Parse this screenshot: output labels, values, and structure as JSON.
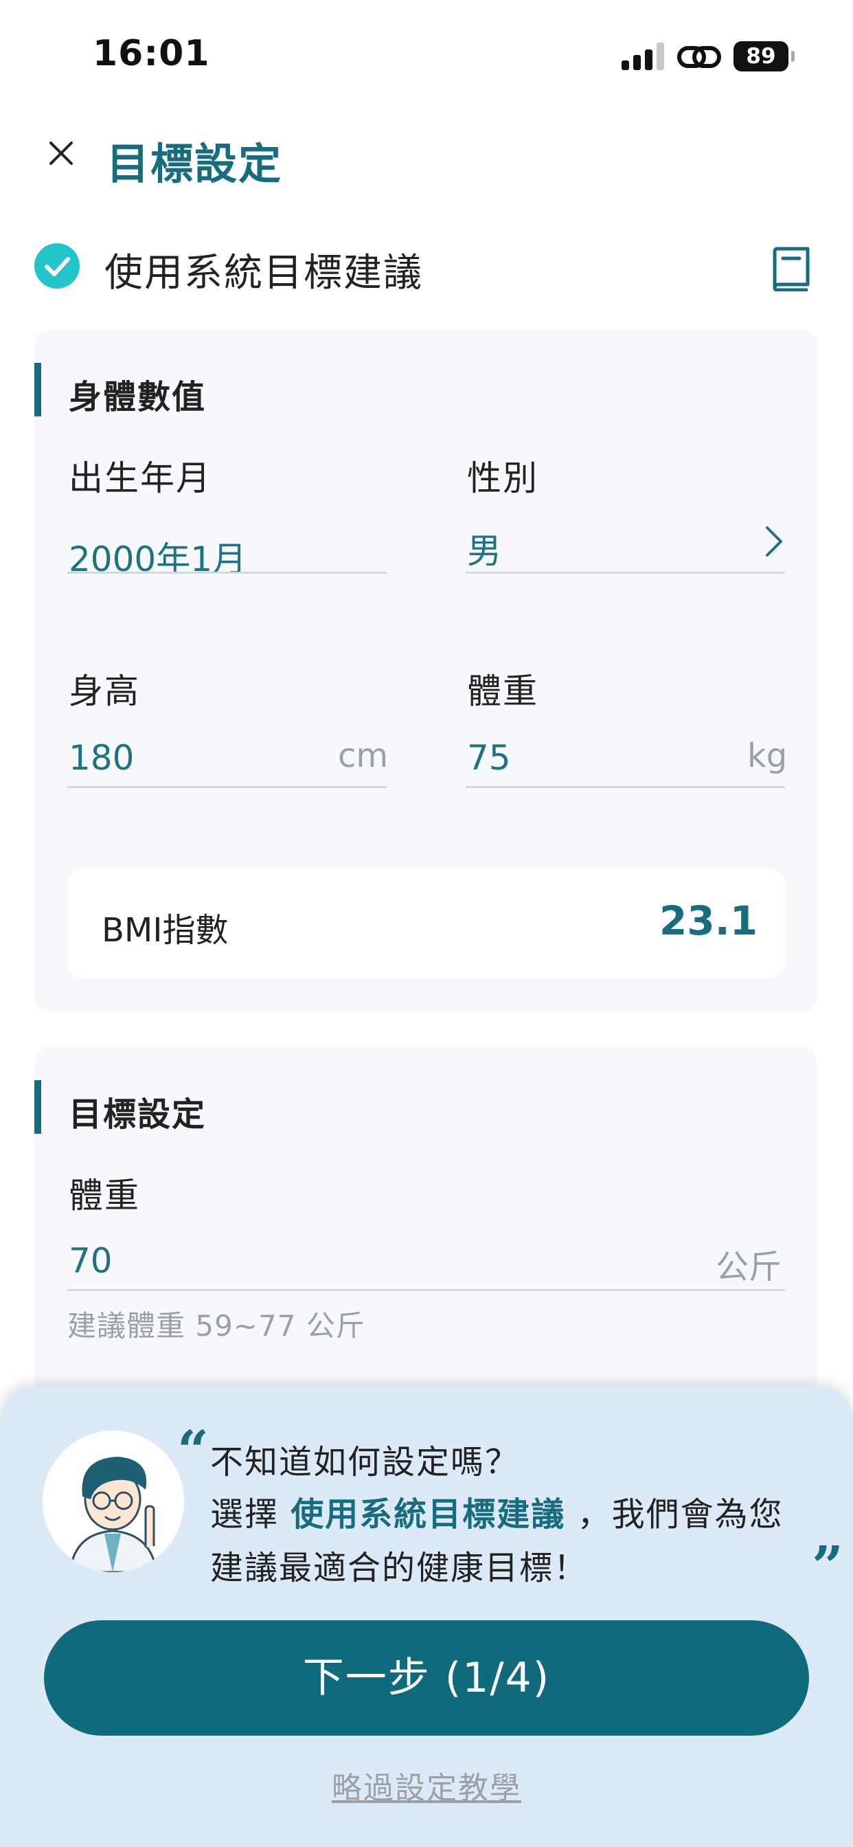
{
  "status_bar": {
    "time": "16:01",
    "battery": "89"
  },
  "header": {
    "title": "目標設定",
    "close_icon": "close-icon"
  },
  "system_suggestion": {
    "label": "使用系統目標建議",
    "checked": true,
    "icon": "book-icon"
  },
  "body_values": {
    "title": "身體數值",
    "birth": {
      "label": "出生年月",
      "value": "2000年1月"
    },
    "gender": {
      "label": "性別",
      "value": "男"
    },
    "height": {
      "label": "身高",
      "value": "180",
      "unit": "cm"
    },
    "weight": {
      "label": "體重",
      "value": "75",
      "unit": "kg"
    },
    "bmi": {
      "label": "BMI指數",
      "value": "23.1"
    }
  },
  "goal": {
    "title": "目標設定",
    "weight": {
      "label": "體重",
      "value": "70",
      "unit": "公斤"
    },
    "hint": "建議體重 59~77 公斤"
  },
  "tip": {
    "open_quote": "“",
    "close_quote": "”",
    "line1": "不知道如何設定嗎？",
    "line2_prefix": "選擇",
    "line2_highlight": "使用系統目標建議",
    "line2_suffix": "，我們會為您",
    "line3": "建議最適合的健康目標！"
  },
  "actions": {
    "next": "下一步 (1/4)",
    "skip": "略過設定教學"
  },
  "colors": {
    "accent": "#176d7d",
    "button": "#0f6b7b",
    "check": "#22c5ca",
    "sheet": "#dceaf8"
  }
}
